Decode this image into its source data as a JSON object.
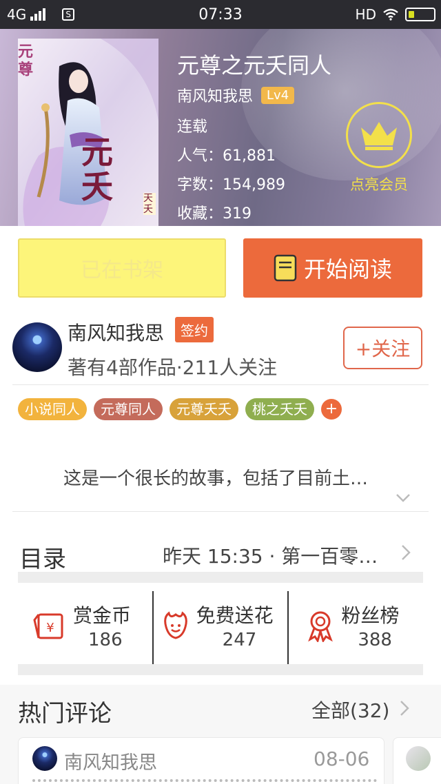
{
  "status_bar": {
    "network": "4G",
    "time": "07:33",
    "hd": "HD",
    "icons": [
      "signal-icon",
      "s-app-icon",
      "wifi-icon",
      "battery-icon"
    ]
  },
  "book": {
    "title": "元尊之元夭同人",
    "author": "南风知我思",
    "level": "Lv4",
    "status": "连载",
    "popularity_label": "人气：",
    "popularity": "61,881",
    "words_label": "字数：",
    "words": "154,989",
    "favorites_label": "收藏：",
    "favorites": "319",
    "cover_text": {
      "big": "元夭",
      "side": "元尊",
      "small": "天夭"
    }
  },
  "vip": {
    "label": "点亮会员",
    "icon": "crown-icon"
  },
  "actions": {
    "shelf_label": "已在书架",
    "read_label": "开始阅读",
    "read_icon": "book-icon"
  },
  "author": {
    "name": "南风知我思",
    "badge": "签约",
    "meta": "著有4部作品·211人关注",
    "follow_label": "+关注"
  },
  "tags": [
    {
      "label": "小说同人",
      "color": "#f2b33d"
    },
    {
      "label": "元尊同人",
      "color": "#c46b5b"
    },
    {
      "label": "元尊夭夭",
      "color": "#d8a23a"
    },
    {
      "label": "桃之夭夭",
      "color": "#8fae4f"
    }
  ],
  "tag_add": "+",
  "description": "这是一个很长的故事，包括了目前土…",
  "toc": {
    "title": "目录",
    "latest": "昨天 15:35 · 第一百零…"
  },
  "stats": [
    {
      "label": "赏金币",
      "value": "186",
      "icon": "red-envelope-icon"
    },
    {
      "label": "免费送花",
      "value": "247",
      "icon": "flower-icon"
    },
    {
      "label": "粉丝榜",
      "value": "388",
      "icon": "medal-icon"
    }
  ],
  "comments": {
    "title": "热门评论",
    "all_label": "全部(32)",
    "items": [
      {
        "name": "南风知我思",
        "date": "08-06"
      }
    ]
  },
  "colors": {
    "accent": "#ec6a3c",
    "shelf_button": "#fdf57a",
    "vip": "#f3e04a",
    "level_badge": "#f2b84b"
  }
}
